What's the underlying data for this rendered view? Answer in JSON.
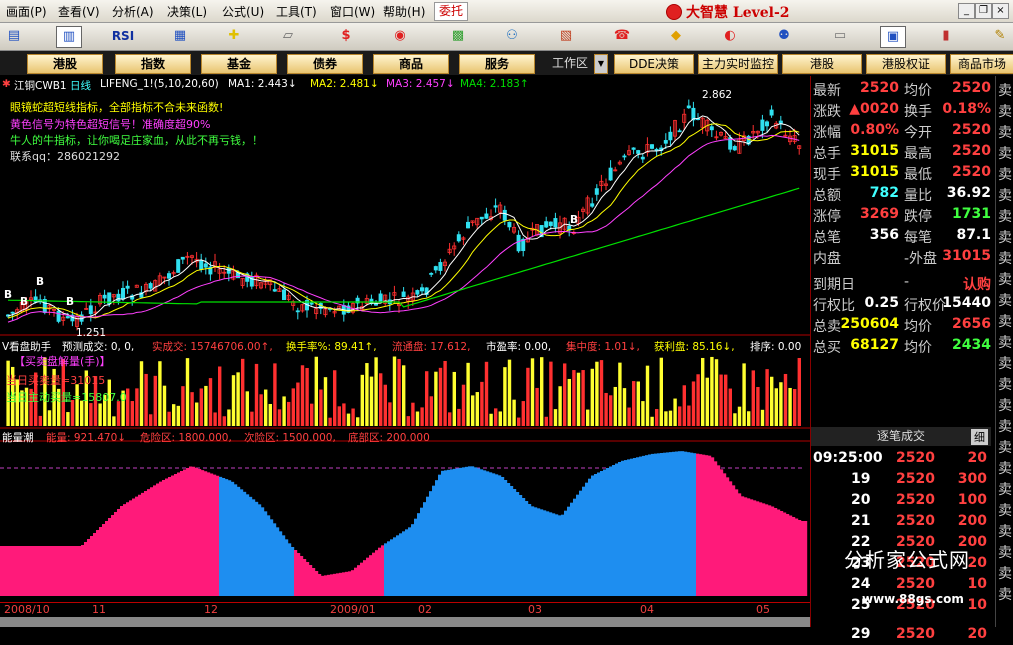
{
  "menu": {
    "items": [
      "画面(P)",
      "查看(V)",
      "分析(A)",
      "决策(L)",
      "公式(U)",
      "工具(T)",
      "窗口(W)",
      "帮助(H)"
    ],
    "weituo": "委托",
    "brand": "大智慧 Level-2"
  },
  "toolbar": {
    "rsi_label": "RSI",
    "dollar_label": "$"
  },
  "nav": {
    "buttons": [
      "港股",
      "指数",
      "基金",
      "债券",
      "商品",
      "服务"
    ],
    "workspace": "工作区",
    "right_buttons": [
      "DDE决策",
      "主力实时监控",
      "港股",
      "港股权证",
      "商品市场"
    ]
  },
  "kline": {
    "name": "江铜CWB1",
    "period": "日线",
    "indicator": "LIFENG_1!(5,10,20,60)",
    "ma1": "MA1: 2.443↓",
    "ma2": "MA2: 2.481↓",
    "ma3": "MA3: 2.457↓",
    "ma4": "MA4: 2.183↑",
    "notes": [
      "眼镜蛇超短线指标，全部指标不合未来函数!",
      "黄色信号为特色超短信号！准确度超90%",
      "牛人的牛指标，让你喝足庄家血，从此不再亏钱，！",
      "联系qq：286021292"
    ],
    "high_label": "2.862",
    "low_label": "1.251",
    "b_marks": [
      "B",
      "B",
      "B",
      "B",
      "B"
    ]
  },
  "volume": {
    "title": "V看盘助手",
    "forecast": "预测成交: 0, 0,",
    "real": "实成交: 15746706.00↑,",
    "turnover": "换手率%: 89.41↑,",
    "float": "流通盘: 17.612,",
    "pe": "市盈率: 0.00,",
    "concentration": "集中度: 1.01↓,",
    "profit": "获利盘: 85.16↓,",
    "rank": "排序: 0.00",
    "sub1": "【买卖盘解量(手)】",
    "sub2": "当日买卖量=31015",
    "sub3": "当日主动买量=15807.0"
  },
  "energy": {
    "title": "能量潮",
    "energy": "能量: 921.470↓",
    "danger": "危险区: 1800.000,",
    "second": "次险区: 1500.000,",
    "bottom": "底部区: 200.000"
  },
  "dates": [
    "2008/10",
    "11",
    "12",
    "2009/01",
    "02",
    "03",
    "04",
    "05"
  ],
  "quote": {
    "rows": [
      {
        "l1": "最新",
        "v1": "2520",
        "l2": "均价",
        "v2": "2520"
      },
      {
        "l1": "涨跌",
        "v1": "▲0020",
        "l2": "换手",
        "v2": "0.18%"
      },
      {
        "l1": "涨幅",
        "v1": "0.80%",
        "l2": "今开",
        "v2": "2520"
      },
      {
        "l1": "总手",
        "v1": "31015",
        "l2": "最高",
        "v2": "2520"
      },
      {
        "l1": "现手",
        "v1": "31015",
        "l2": "最低",
        "v2": "2520"
      },
      {
        "l1": "总额",
        "v1": "782",
        "l2": "量比",
        "v2": "36.92"
      },
      {
        "l1": "涨停",
        "v1": "3269",
        "l2": "跌停",
        "v2": "1731"
      },
      {
        "l1": "总笔",
        "v1": "356",
        "l2": "每笔",
        "v2": "87.1"
      },
      {
        "l1": "内盘",
        "v1": "",
        "l2": "-外盘",
        "v2": "31015"
      },
      {
        "l1": "到期日",
        "v1": "",
        "l2": "-",
        "v2": "认购"
      },
      {
        "l1": "行权比",
        "v1": "0.25",
        "l2": "行权价",
        "v2": "15440"
      },
      {
        "l1": "总卖",
        "v1": "250604",
        "l2": "均价",
        "v2": "2656"
      },
      {
        "l1": "总买",
        "v1": "68127",
        "l2": "均价",
        "v2": "2434"
      }
    ],
    "ticks_title": "逐笔成交",
    "ticks_tab": "细",
    "ticks": [
      {
        "t": "09:25:00",
        "p": "2520",
        "v": "20"
      },
      {
        "t": "19",
        "p": "2520",
        "v": "300"
      },
      {
        "t": "20",
        "p": "2520",
        "v": "100"
      },
      {
        "t": "21",
        "p": "2520",
        "v": "200"
      },
      {
        "t": "22",
        "p": "2520",
        "v": "200"
      },
      {
        "t": "23",
        "p": "2520",
        "v": "20"
      },
      {
        "t": "24",
        "p": "2520",
        "v": "10"
      },
      {
        "t": "25",
        "p": "2520",
        "v": "10"
      },
      {
        "t": "29",
        "p": "2520",
        "v": "20"
      }
    ],
    "side_labels": [
      "卖",
      "卖",
      "卖",
      "卖",
      "卖",
      "卖",
      "卖",
      "卖",
      "卖",
      "卖",
      "卖",
      "卖",
      "卖",
      "卖",
      "卖",
      "卖",
      "卖",
      "卖",
      "卖",
      "卖",
      "卖",
      "卖",
      "卖",
      "卖",
      "卖"
    ]
  },
  "watermark": {
    "name": "分析家公式网",
    "url": "www.88gs.com"
  },
  "colors": {
    "up": "#ff3030",
    "down": "#30e0f0",
    "ma1": "#ffffff",
    "ma2": "#ffff00",
    "ma3": "#ff40ff",
    "ma4": "#00e000",
    "energy_pink": "#ff1a7a",
    "energy_blue": "#1e8ef0"
  }
}
